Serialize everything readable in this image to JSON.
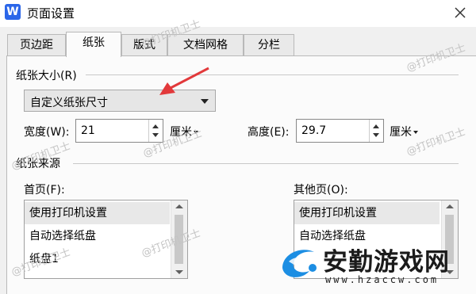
{
  "window": {
    "app_icon_letter": "W",
    "title": "页面设置"
  },
  "tabs": [
    {
      "label": "页边距",
      "active": false
    },
    {
      "label": "纸张",
      "active": true
    },
    {
      "label": "版式",
      "active": false
    },
    {
      "label": "文档网格",
      "active": false
    },
    {
      "label": "分栏",
      "active": false
    }
  ],
  "paper_size": {
    "section_label": "纸张大小(R)",
    "selected": "自定义纸张尺寸",
    "width_label": "宽度(W):",
    "width_value": "21",
    "width_unit": "厘米",
    "height_label": "高度(E):",
    "height_value": "29.7",
    "height_unit": "厘米"
  },
  "paper_source": {
    "section_label": "纸张来源",
    "first_page_label": "首页(F):",
    "other_pages_label": "其他页(O):",
    "first_page_items": [
      "使用打印机设置",
      "自动选择纸盘",
      "纸盘1"
    ],
    "other_pages_items": [
      "使用打印机设置",
      "自动选择纸盘"
    ]
  },
  "watermark_text": "@打印机卫士",
  "brand": {
    "name": "安勤游戏网",
    "url": "www.hzaccw.com"
  },
  "colors": {
    "arrow": "#e2393b",
    "brand_blue": "#1c8ee3",
    "app_icon": "#2b66e9"
  }
}
